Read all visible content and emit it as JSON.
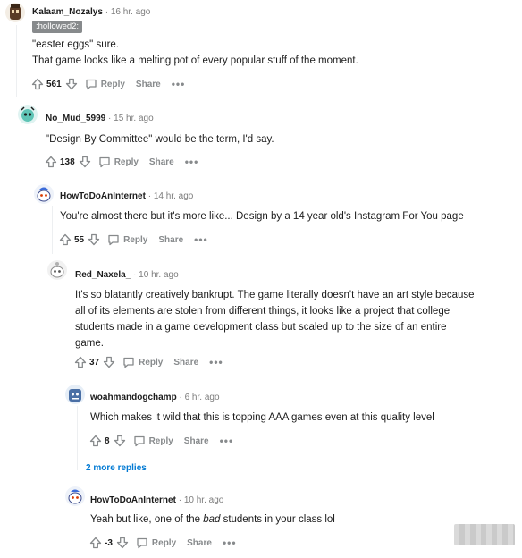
{
  "comments": [
    {
      "username": "Kalaam_Nozalys",
      "time": "16 hr. ago",
      "flair": ":hollowed2:",
      "lines": [
        "\"easter eggs\" sure.",
        "That game looks like a melting pot of every popular stuff of the moment."
      ],
      "votes": "561",
      "reply": "Reply",
      "share": "Share"
    },
    {
      "username": "No_Mud_5999",
      "time": "15 hr. ago",
      "lines": [
        "\"Design By Committee\" would be the term, I'd say."
      ],
      "votes": "138",
      "reply": "Reply",
      "share": "Share"
    },
    {
      "username": "HowToDoAnInternet",
      "time": "14 hr. ago",
      "lines": [
        "You're almost there but it's more like... Design by a 14 year old's Instagram For You page"
      ],
      "votes": "55",
      "reply": "Reply",
      "share": "Share"
    },
    {
      "username": "Red_Naxela_",
      "time": "10 hr. ago",
      "lines": [
        "It's so blatantly creatively bankrupt. The game literally doesn't have an art style because",
        "all of its elements are stolen from different things, it looks like a project that college",
        "students made in a game development class but scaled up to the size of an entire",
        "game."
      ],
      "votes": "37",
      "reply": "Reply",
      "share": "Share"
    },
    {
      "username": "woahmandogchamp",
      "time": "6 hr. ago",
      "lines": [
        "Which makes it wild that this is topping AAA games even at this quality level"
      ],
      "votes": "8",
      "reply": "Reply",
      "share": "Share"
    },
    {
      "username": "HowToDoAnInternet",
      "time": "10 hr. ago",
      "line_prefix": "Yeah but like, one of the ",
      "line_emphasis": "bad",
      "line_suffix": " students in your class lol",
      "votes": "-3",
      "reply": "Reply",
      "share": "Share"
    }
  ],
  "more_replies": "2 more replies",
  "separator": "·",
  "more_glyph": "•••",
  "colors": {
    "meta_gray": "#7c7c7c",
    "action_gray": "#878a8c",
    "link_blue": "#0079d3",
    "flair_bg": "#878a8c"
  }
}
